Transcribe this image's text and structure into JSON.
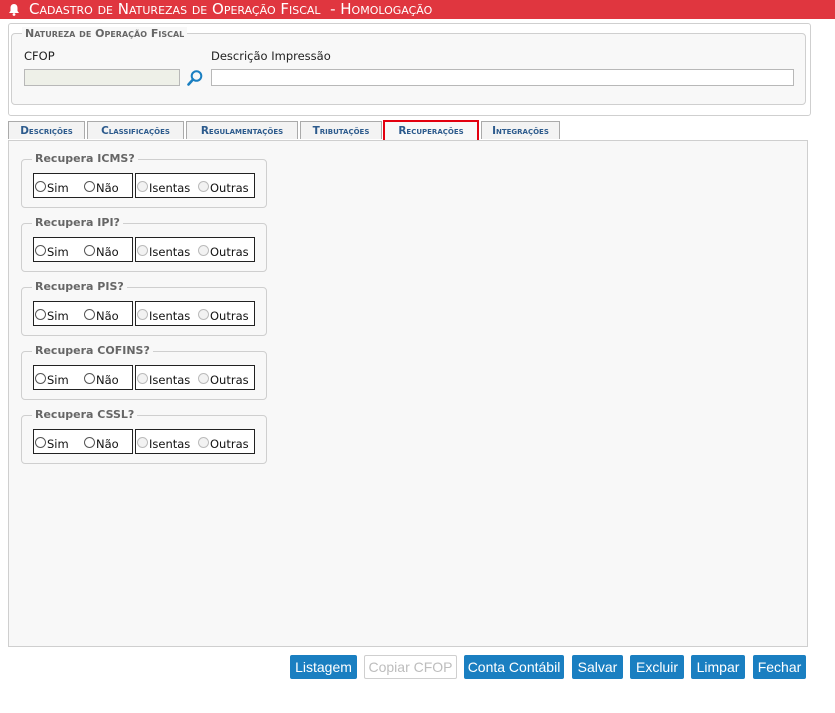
{
  "window": {
    "title": "Cadastro de Naturezas de Operação Fiscal  - Homologação",
    "title_bar_color": "#e0363f",
    "icon": "bell-icon"
  },
  "natureza": {
    "legend": "Natureza de Operação Fiscal",
    "cfop_label": "CFOP",
    "cfop_value": "",
    "descricao_label": "Descrição Impressão",
    "descricao_value": "",
    "search_icon": "magnifier-icon"
  },
  "tabs": [
    {
      "label": "Descrições"
    },
    {
      "label": "Classificações"
    },
    {
      "label": "Regulamentações"
    },
    {
      "label": "Tributações"
    },
    {
      "label": "Recuperações",
      "active": true
    },
    {
      "label": "Integrações"
    }
  ],
  "groups": [
    {
      "legend": "Recupera ICMS?",
      "options": [
        "Sim",
        "Não",
        "Isentas",
        "Outras"
      ]
    },
    {
      "legend": "Recupera IPI?",
      "options": [
        "Sim",
        "Não",
        "Isentas",
        "Outras"
      ]
    },
    {
      "legend": "Recupera PIS?",
      "options": [
        "Sim",
        "Não",
        "Isentas",
        "Outras"
      ]
    },
    {
      "legend": "Recupera COFINS?",
      "options": [
        "Sim",
        "Não",
        "Isentas",
        "Outras"
      ]
    },
    {
      "legend": "Recupera CSSL?",
      "options": [
        "Sim",
        "Não",
        "Isentas",
        "Outras"
      ]
    }
  ],
  "buttons": {
    "listagem": "Listagem",
    "copiar_cfop": "Copiar CFOP",
    "conta_contabil": "Conta Contábil",
    "salvar": "Salvar",
    "excluir": "Excluir",
    "limpar": "Limpar",
    "fechar": "Fechar"
  },
  "colors": {
    "button": "#1a7fc1",
    "active_tab_border": "#e3000f",
    "tab_text": "#2c5a8c"
  }
}
